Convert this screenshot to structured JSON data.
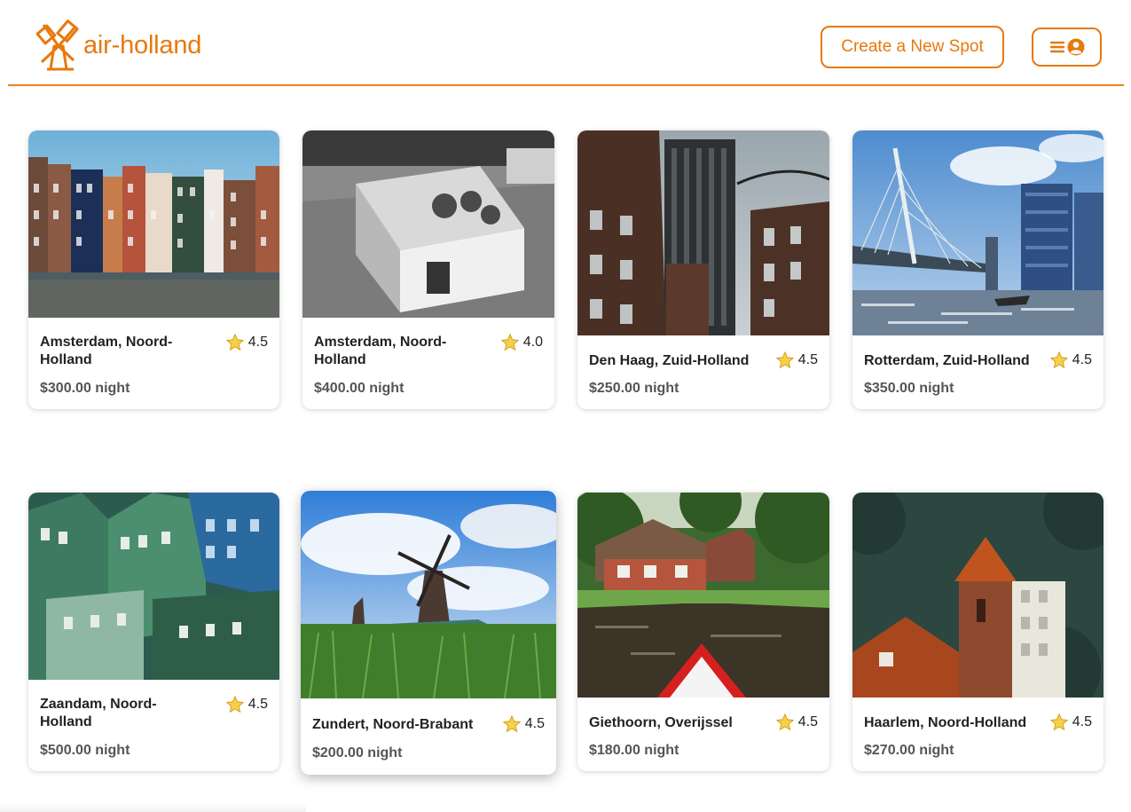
{
  "header": {
    "logo_text": "air-holland",
    "create_label": "Create a New Spot",
    "accent_color": "#e8780e",
    "menu_icons": [
      "hamburger-icon",
      "user-circle-icon"
    ]
  },
  "spots": [
    {
      "location": "Amsterdam, Noord-Holland",
      "rating": "4.5",
      "price": "$300.00",
      "unit": "night",
      "image": "canal-houses"
    },
    {
      "location": "Amsterdam, Noord-Holland",
      "rating": "4.0",
      "price": "$400.00",
      "unit": "night",
      "image": "houseboat-bw"
    },
    {
      "location": "Den Haag, Zuid-Holland",
      "rating": "4.5",
      "price": "$250.00",
      "unit": "night",
      "image": "city-towers"
    },
    {
      "location": "Rotterdam, Zuid-Holland",
      "rating": "4.5",
      "price": "$350.00",
      "unit": "night",
      "image": "erasmus-bridge"
    },
    {
      "location": "Zaandam, Noord-Holland",
      "rating": "4.5",
      "price": "$500.00",
      "unit": "night",
      "image": "stacked-green-houses"
    },
    {
      "location": "Zundert, Noord-Brabant",
      "rating": "4.5",
      "price": "$200.00",
      "unit": "night",
      "image": "windmill-field"
    },
    {
      "location": "Giethoorn, Overijssel",
      "rating": "4.5",
      "price": "$180.00",
      "unit": "night",
      "image": "canal-boat"
    },
    {
      "location": "Haarlem, Noord-Holland",
      "rating": "4.5",
      "price": "$270.00",
      "unit": "night",
      "image": "brick-tower"
    }
  ]
}
